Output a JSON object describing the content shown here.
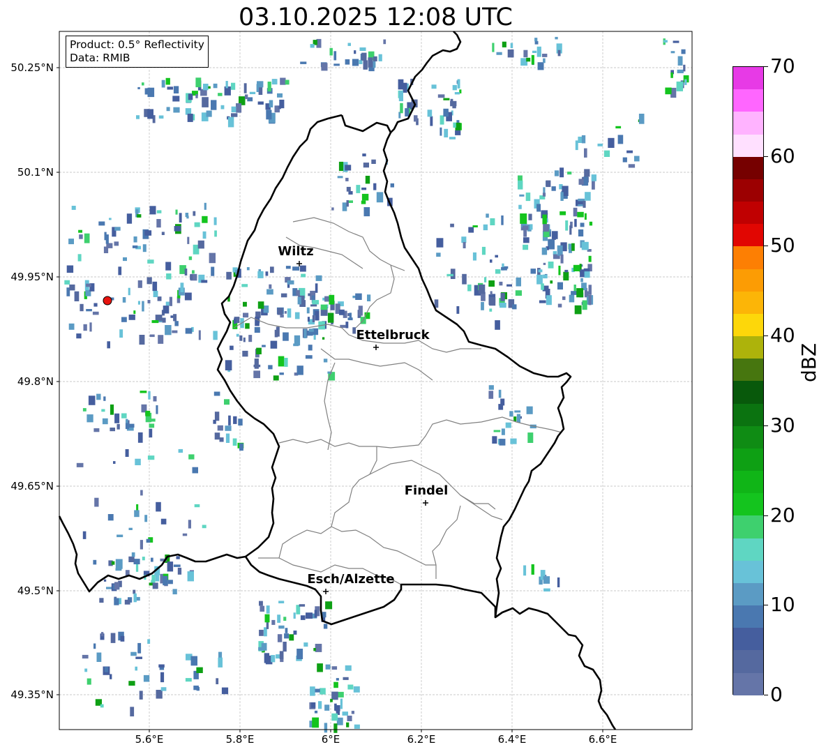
{
  "title": "03.10.2025 12:08 UTC",
  "info": {
    "product": "Product: 0.5° Reflectivity",
    "data": "Data: RMIB"
  },
  "lat_labels": [
    "50.25°N",
    "50.1°N",
    "49.95°N",
    "49.8°N",
    "49.65°N",
    "49.5°N",
    "49.35°N"
  ],
  "lon_labels": [
    "5.6°E",
    "5.8°E",
    "6°E",
    "6.2°E",
    "6.4°E",
    "6.6°E"
  ],
  "cities": [
    "Wiltz",
    "Ettelbruck",
    "Findel",
    "Esch/Alzette"
  ],
  "radar_site_color": "#e8140f",
  "colorbar": {
    "unit": "dBZ",
    "tick_labels": [
      "0",
      "10",
      "20",
      "30",
      "40",
      "50",
      "60",
      "70"
    ],
    "min": 0,
    "max": 70,
    "colors": [
      "#6575a8",
      "#55699f",
      "#455e9e",
      "#4a78b0",
      "#5b9bc4",
      "#68c2d8",
      "#5fd6c2",
      "#3ed06e",
      "#14c41e",
      "#10b517",
      "#0ea014",
      "#0f8c14",
      "#0b7310",
      "#08590b",
      "#47760f",
      "#adb30b",
      "#fdd70a",
      "#fcb507",
      "#fc9c04",
      "#fd7f03",
      "#e10602",
      "#c00001",
      "#9c0001",
      "#760000",
      "#ffe0ff",
      "#ffb3ff",
      "#ff66ff",
      "#e73ae6"
    ]
  }
}
